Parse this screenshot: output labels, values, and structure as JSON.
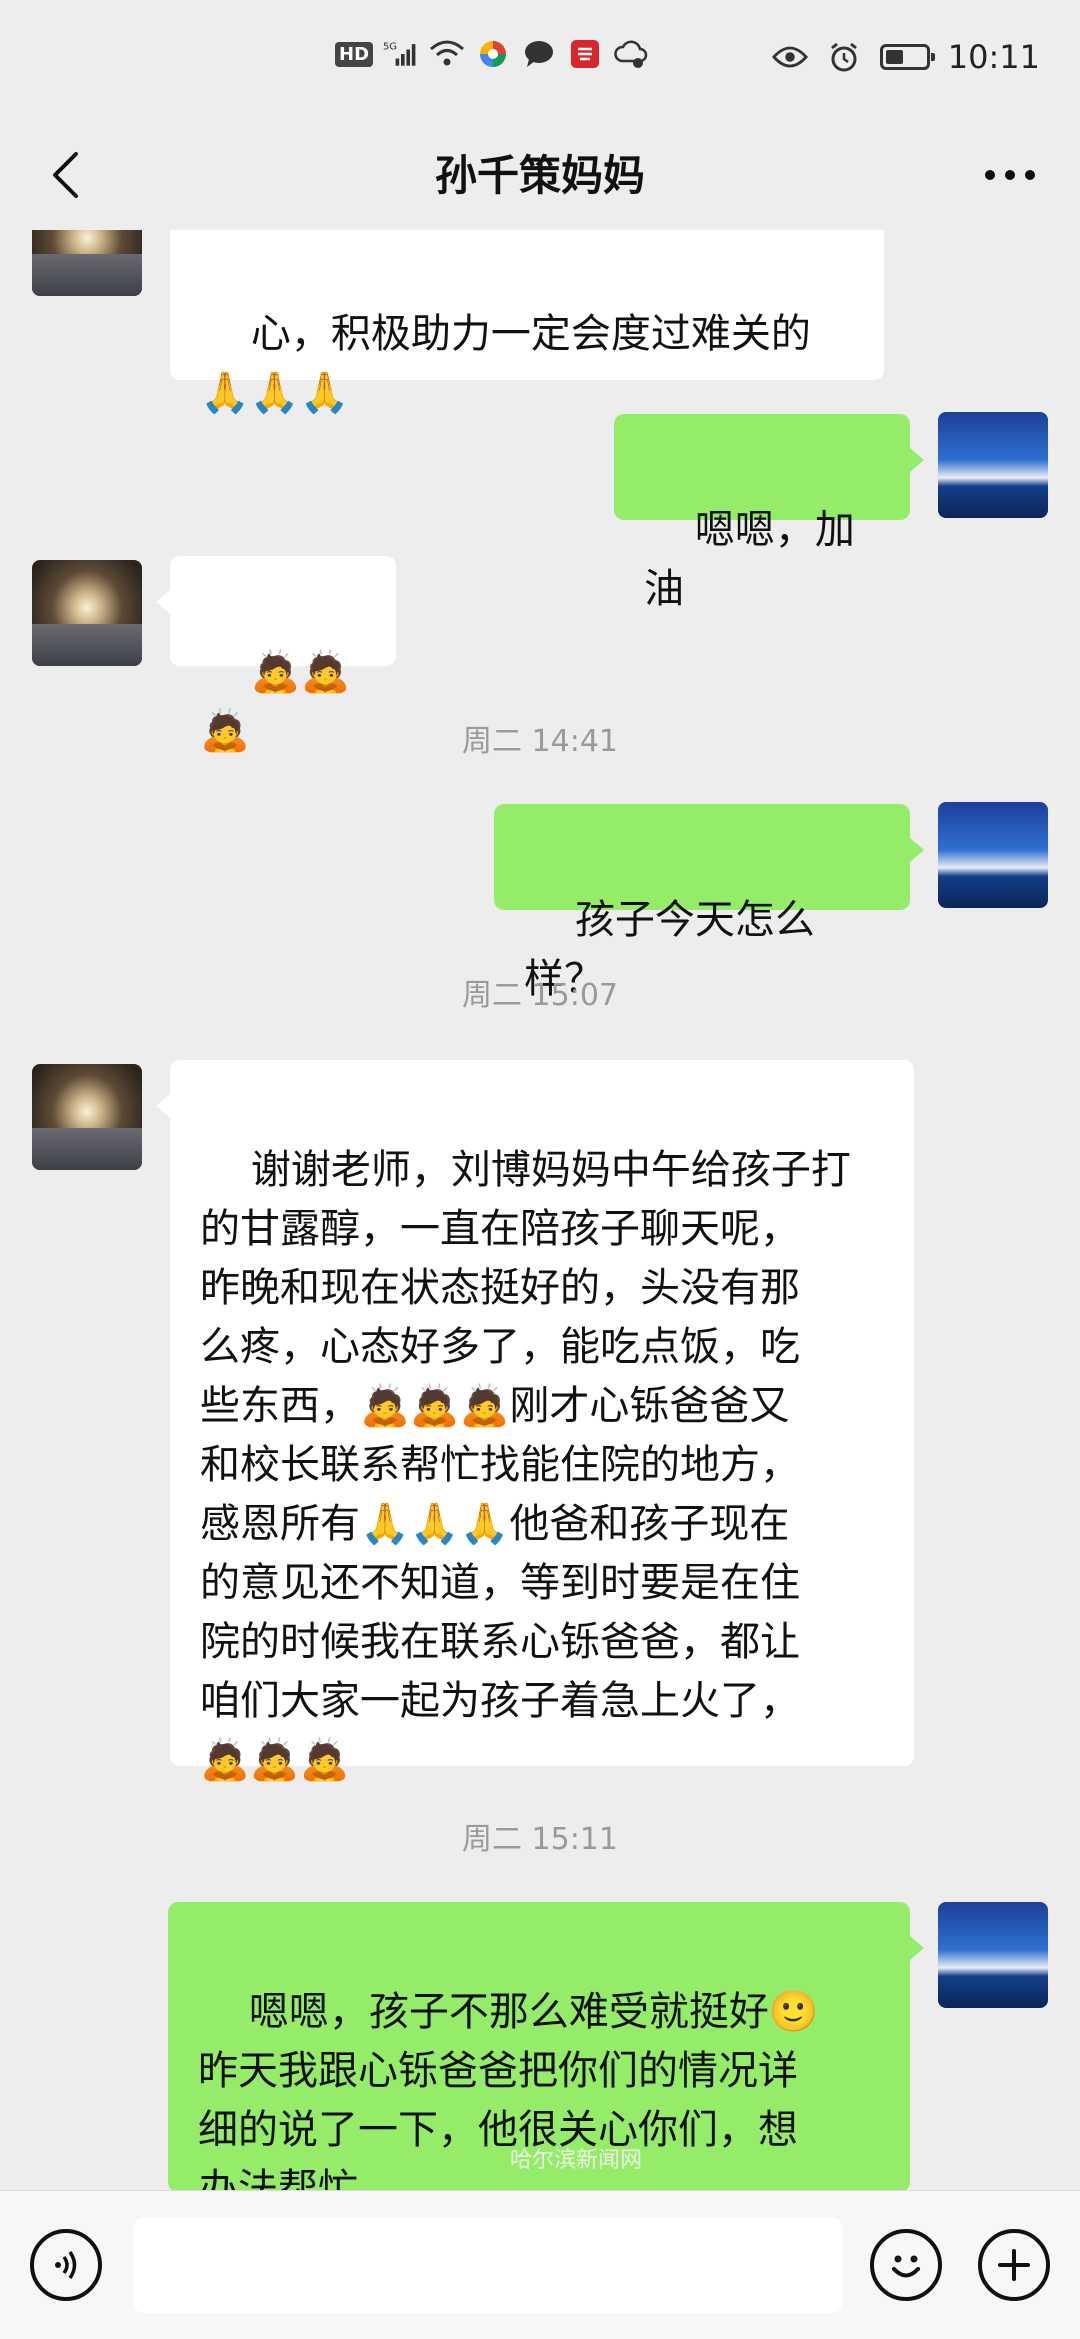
{
  "status_bar": {
    "hd": "HD",
    "network": "5G",
    "time": "10:11"
  },
  "header": {
    "title": "孙千策妈妈"
  },
  "messages": [
    {
      "side": "left",
      "text": "心，积极助力一定会度过难关的\n🙏🙏🙏"
    },
    {
      "side": "right",
      "text": "嗯嗯，加油"
    },
    {
      "side": "left",
      "text": "🙇🙇🙇"
    },
    {
      "type": "time",
      "text": "周二 14:41"
    },
    {
      "side": "right",
      "text": "孩子今天怎么样？"
    },
    {
      "type": "time",
      "text": "周二 15:07"
    },
    {
      "side": "left",
      "text": "谢谢老师，刘博妈妈中午给孩子打\n的甘露醇，一直在陪孩子聊天呢，\n昨晚和现在状态挺好的，头没有那\n么疼，心态好多了，能吃点饭，吃\n些东西，🙇🙇🙇刚才心铄爸爸又\n和校长联系帮忙找能住院的地方，\n感恩所有🙏🙏🙏他爸和孩子现在\n的意见还不知道，等到时要是在住\n院的时候我在联系心铄爸爸，都让\n咱们大家一起为孩子着急上火了，\n🙇🙇🙇"
    },
    {
      "type": "time",
      "text": "周二 15:11"
    },
    {
      "side": "right",
      "text": "嗯嗯，孩子不那么难受就挺好🙂\n昨天我跟心铄爸爸把你们的情况详\n细的说了一下，他很关心你们，想\n办法帮忙。"
    }
  ],
  "watermark": "哈尔滨新闻网",
  "input_bar": {
    "placeholder": ""
  }
}
